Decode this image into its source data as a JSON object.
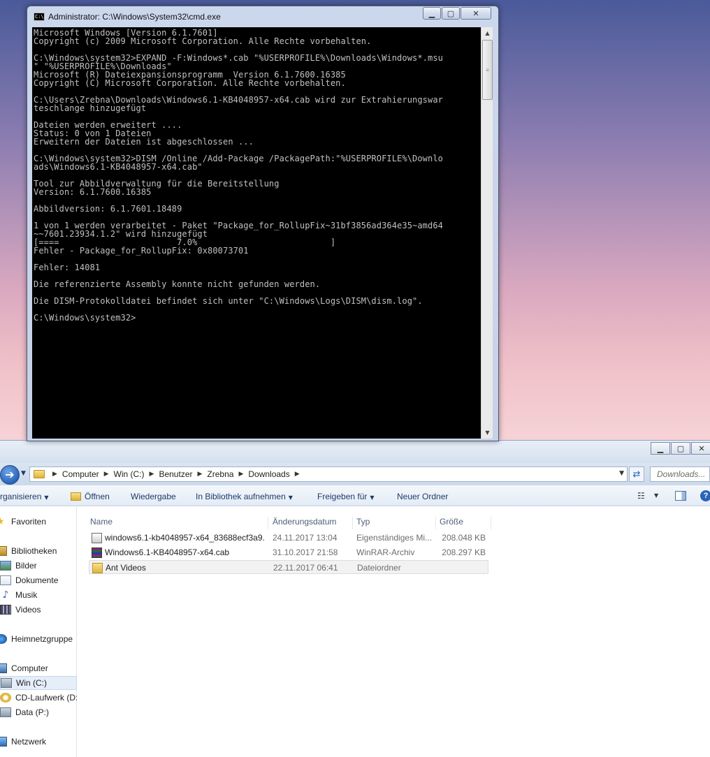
{
  "cmd": {
    "title": "Administrator: C:\\Windows\\System32\\cmd.exe",
    "icon_label": "C:\\.",
    "lines": [
      "Microsoft Windows [Version 6.1.7601]",
      "Copyright (c) 2009 Microsoft Corporation. Alle Rechte vorbehalten.",
      "",
      "C:\\Windows\\system32>EXPAND -F:Windows*.cab \"%USERPROFILE%\\Downloads\\Windows*.msu",
      "\" \"%USERPROFILE%\\Downloads\"",
      "Microsoft (R) Dateiexpansionsprogramm  Version 6.1.7600.16385",
      "Copyright (C) Microsoft Corporation. Alle Rechte vorbehalten.",
      "",
      "C:\\Users\\Zrebna\\Downloads\\Windows6.1-KB4048957-x64.cab wird zur Extrahierungswar",
      "teschlange hinzugefügt",
      "",
      "Dateien werden erweitert ....",
      "Status: 0 von 1 Dateien",
      "Erweitern der Dateien ist abgeschlossen ...",
      "",
      "C:\\Windows\\system32>DISM /Online /Add-Package /PackagePath:\"%USERPROFILE%\\Downlo",
      "ads\\Windows6.1-KB4048957-x64.cab\"",
      "",
      "Tool zur Abbildverwaltung für die Bereitstellung",
      "Version: 6.1.7600.16385",
      "",
      "Abbildversion: 6.1.7601.18489",
      "",
      "1 von 1 werden verarbeitet - Paket \"Package_for_RollupFix~31bf3856ad364e35~amd64",
      "~~7601.23934.1.2\" wird hinzugefügt",
      "[====                       7.0%                          ]",
      "Fehler - Package_for_RollupFix: 0x80073701",
      "",
      "Fehler: 14081",
      "",
      "Die referenzierte Assembly konnte nicht gefunden werden.",
      "",
      "Die DISM-Protokolldatei befindet sich unter \"C:\\Windows\\Logs\\DISM\\dism.log\".",
      "",
      "C:\\Windows\\system32>"
    ],
    "progress_percent": 7.0
  },
  "explorer": {
    "breadcrumb": [
      "Computer",
      "Win (C:)",
      "Benutzer",
      "Zrebna",
      "Downloads"
    ],
    "search_placeholder": "Downloads...",
    "toolbar": {
      "organize": "rganisieren",
      "open": "Öffnen",
      "play": "Wiedergabe",
      "include_library": "In Bibliothek aufnehmen",
      "share_with": "Freigeben für",
      "new_folder": "Neuer Ordner"
    },
    "nav": {
      "favorites": "Favoriten",
      "libraries": "Bibliotheken",
      "pictures": "Bilder",
      "documents": "Dokumente",
      "music": "Musik",
      "videos": "Videos",
      "homegroup": "Heimnetzgruppe",
      "computer": "Computer",
      "win_c": "Win (C:)",
      "cd_drive": "CD-Laufwerk (D:",
      "data_p": "Data (P:)",
      "network": "Netzwerk"
    },
    "columns": {
      "name": "Name",
      "date": "Änderungsdatum",
      "type": "Typ",
      "size": "Größe"
    },
    "files": [
      {
        "name": "windows6.1-kb4048957-x64_83688ecf3a9...",
        "date": "24.11.2017 13:04",
        "type": "Eigenständiges Mi...",
        "size": "208.048 KB",
        "icon": "installer-icon"
      },
      {
        "name": "Windows6.1-KB4048957-x64.cab",
        "date": "31.10.2017 21:58",
        "type": "WinRAR-Archiv",
        "size": "208.297 KB",
        "icon": "winrar-icon"
      },
      {
        "name": "Ant Videos",
        "date": "22.11.2017 06:41",
        "type": "Dateiordner",
        "size": "",
        "icon": "folder-icon"
      }
    ]
  }
}
